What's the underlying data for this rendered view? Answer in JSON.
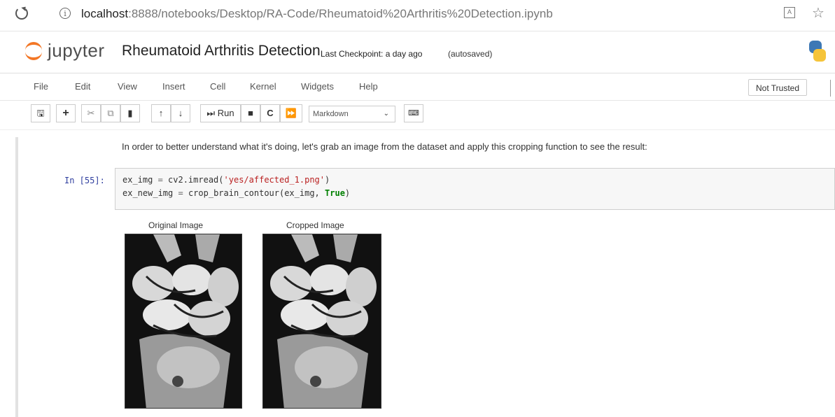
{
  "browser": {
    "url_host": "localhost",
    "url_path": ":8888/notebooks/Desktop/RA-Code/Rheumatoid%20Arthritis%20Detection.ipynb"
  },
  "header": {
    "app_name": "jupyter",
    "notebook_title": "Rheumatoid Arthritis Detection",
    "checkpoint": "Last Checkpoint: a day ago",
    "autosave": "(autosaved)"
  },
  "menu": {
    "items": [
      "File",
      "Edit",
      "View",
      "Insert",
      "Cell",
      "Kernel",
      "Widgets",
      "Help"
    ],
    "trust_status": "Not Trusted"
  },
  "toolbar": {
    "run_label": "Run",
    "cell_type": "Markdown",
    "cell_type_options": [
      "Markdown"
    ]
  },
  "notebook": {
    "markdown_text": "In order to better understand what it's doing, let's grab an image from the dataset and apply this cropping function to see the result:",
    "prompt": "In [55]:",
    "code": {
      "line1_a": "ex_img ",
      "line1_op": "=",
      "line1_b": " cv2.imread(",
      "line1_str": "'yes/affected_1.png'",
      "line1_c": ")",
      "line2_a": "ex_new_img ",
      "line2_op": "=",
      "line2_b": " crop_brain_contour(ex_img, ",
      "line2_kw": "True",
      "line2_c": ")"
    },
    "output": {
      "original_title": "Original Image",
      "cropped_title": "Cropped Image"
    }
  },
  "icons": {
    "reload": "reload-icon",
    "info": "info-icon",
    "reader": "reader-view-icon",
    "favorite": "star-icon",
    "save": "floppy-disk-icon",
    "insert": "plus-icon",
    "cut": "scissors-icon",
    "copy": "copy-icon",
    "paste": "paste-icon",
    "move_up": "arrow-up-icon",
    "move_down": "arrow-down-icon",
    "interrupt": "stop-icon",
    "restart": "restart-icon",
    "restart_run_all": "fast-forward-icon",
    "command_palette": "keyboard-icon"
  },
  "colors": {
    "jupyter_orange": "#f37726",
    "prompt_blue": "#303f9f",
    "string_red": "#ba2121",
    "keyword_green": "#008000"
  }
}
